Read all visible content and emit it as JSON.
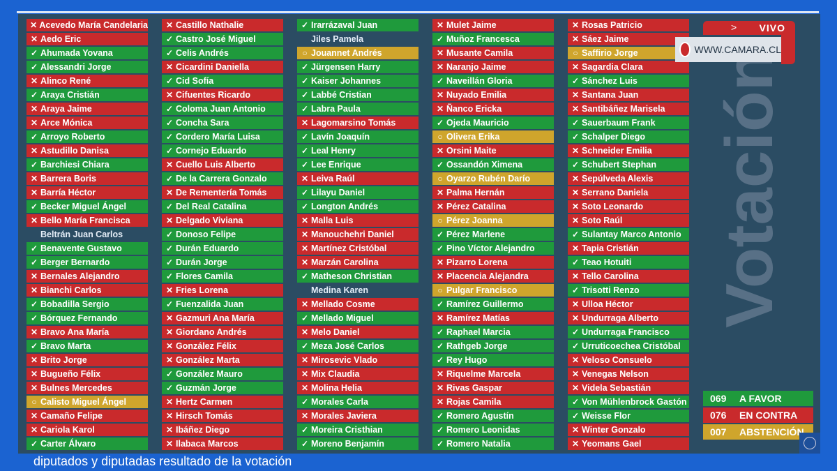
{
  "header": {
    "live_label": "VIVO",
    "url": "WWW.CAMARA.CL",
    "vertical_title": "Votación"
  },
  "colors": {
    "favor": "#1f9a3c",
    "contra": "#c92a2c",
    "abstencion": "#cfa52c",
    "background": "#1b63d1",
    "panel": "#2b4c63"
  },
  "icons": {
    "y": "check-icon",
    "n": "cross-icon",
    "a": "circle-icon"
  },
  "columns": [
    [
      [
        "n",
        "Acevedo María Candelaria"
      ],
      [
        "n",
        "Aedo Eric"
      ],
      [
        "y",
        "Ahumada Yovana"
      ],
      [
        "y",
        "Alessandri Jorge"
      ],
      [
        "n",
        "Alinco René"
      ],
      [
        "y",
        "Araya Cristián"
      ],
      [
        "n",
        "Araya Jaime"
      ],
      [
        "n",
        "Arce Mónica"
      ],
      [
        "y",
        "Arroyo Roberto"
      ],
      [
        "n",
        "Astudillo Danisa"
      ],
      [
        "y",
        "Barchiesi Chiara"
      ],
      [
        "n",
        "Barrera Boris"
      ],
      [
        "n",
        "Barría Héctor"
      ],
      [
        "y",
        "Becker Miguel Ángel"
      ],
      [
        "n",
        "Bello María Francisca"
      ],
      [
        "",
        "Beltrán Juan Carlos"
      ],
      [
        "y",
        "Benavente Gustavo"
      ],
      [
        "y",
        "Berger Bernardo"
      ],
      [
        "n",
        "Bernales Alejandro"
      ],
      [
        "n",
        "Bianchi Carlos"
      ],
      [
        "y",
        "Bobadilla Sergio"
      ],
      [
        "y",
        "Bórquez Fernando"
      ],
      [
        "n",
        "Bravo Ana María"
      ],
      [
        "y",
        "Bravo Marta"
      ],
      [
        "n",
        "Brito Jorge"
      ],
      [
        "n",
        "Bugueño Félix"
      ],
      [
        "n",
        "Bulnes Mercedes"
      ],
      [
        "a",
        "Calisto Miguel Ángel"
      ],
      [
        "n",
        "Camaño Felipe"
      ],
      [
        "n",
        "Cariola Karol"
      ],
      [
        "y",
        "Carter Álvaro"
      ]
    ],
    [
      [
        "n",
        "Castillo Nathalie"
      ],
      [
        "y",
        "Castro José Miguel"
      ],
      [
        "y",
        "Celis Andrés"
      ],
      [
        "n",
        "Cicardini Daniella"
      ],
      [
        "y",
        "Cid Sofía"
      ],
      [
        "n",
        "Cifuentes Ricardo"
      ],
      [
        "y",
        "Coloma Juan Antonio"
      ],
      [
        "y",
        "Concha Sara"
      ],
      [
        "y",
        "Cordero María Luisa"
      ],
      [
        "y",
        "Cornejo Eduardo"
      ],
      [
        "n",
        "Cuello Luis Alberto"
      ],
      [
        "y",
        "De la Carrera Gonzalo"
      ],
      [
        "n",
        "De Rementería Tomás"
      ],
      [
        "y",
        "Del Real Catalina"
      ],
      [
        "n",
        "Delgado Viviana"
      ],
      [
        "y",
        "Donoso Felipe"
      ],
      [
        "y",
        "Durán Eduardo"
      ],
      [
        "y",
        "Durán Jorge"
      ],
      [
        "y",
        "Flores Camila"
      ],
      [
        "n",
        "Fries Lorena"
      ],
      [
        "y",
        "Fuenzalida Juan"
      ],
      [
        "n",
        "Gazmuri Ana María"
      ],
      [
        "n",
        "Giordano Andrés"
      ],
      [
        "n",
        "González Félix"
      ],
      [
        "n",
        "González Marta"
      ],
      [
        "y",
        "González Mauro"
      ],
      [
        "y",
        "Guzmán Jorge"
      ],
      [
        "n",
        "Hertz Carmen"
      ],
      [
        "n",
        "Hirsch Tomás"
      ],
      [
        "n",
        "Ibáñez Diego"
      ],
      [
        "n",
        "Ilabaca Marcos"
      ]
    ],
    [
      [
        "y",
        "Irarrázaval Juan"
      ],
      [
        "",
        "Jiles Pamela"
      ],
      [
        "a",
        "Jouannet Andrés"
      ],
      [
        "y",
        "Jürgensen Harry"
      ],
      [
        "y",
        "Kaiser Johannes"
      ],
      [
        "y",
        "Labbé Cristian"
      ],
      [
        "y",
        "Labra Paula"
      ],
      [
        "n",
        "Lagomarsino Tomás"
      ],
      [
        "y",
        "Lavín Joaquín"
      ],
      [
        "y",
        "Leal Henry"
      ],
      [
        "y",
        "Lee Enrique"
      ],
      [
        "n",
        "Leiva Raúl"
      ],
      [
        "y",
        "Lilayu Daniel"
      ],
      [
        "y",
        "Longton Andrés"
      ],
      [
        "n",
        "Malla Luis"
      ],
      [
        "n",
        "Manouchehri Daniel"
      ],
      [
        "n",
        "Martínez Cristóbal"
      ],
      [
        "n",
        "Marzán Carolina"
      ],
      [
        "y",
        "Matheson Christian"
      ],
      [
        "",
        "Medina Karen"
      ],
      [
        "n",
        "Mellado Cosme"
      ],
      [
        "y",
        "Mellado Miguel"
      ],
      [
        "n",
        "Melo Daniel"
      ],
      [
        "y",
        "Meza José Carlos"
      ],
      [
        "n",
        "Mirosevic Vlado"
      ],
      [
        "n",
        "Mix Claudia"
      ],
      [
        "n",
        "Molina Helia"
      ],
      [
        "y",
        "Morales Carla"
      ],
      [
        "n",
        "Morales Javiera"
      ],
      [
        "y",
        "Moreira Cristhian"
      ],
      [
        "y",
        "Moreno Benjamín"
      ]
    ],
    [
      [
        "n",
        "Mulet Jaime"
      ],
      [
        "y",
        "Muñoz Francesca"
      ],
      [
        "n",
        "Musante Camila"
      ],
      [
        "n",
        "Naranjo Jaime"
      ],
      [
        "y",
        "Naveillán Gloria"
      ],
      [
        "n",
        "Nuyado Emilia"
      ],
      [
        "n",
        "Ñanco Ericka"
      ],
      [
        "y",
        "Ojeda Mauricio"
      ],
      [
        "a",
        "Olivera Erika"
      ],
      [
        "n",
        "Orsini Maite"
      ],
      [
        "y",
        "Ossandón Ximena"
      ],
      [
        "a",
        "Oyarzo Rubén Darío"
      ],
      [
        "n",
        "Palma Hernán"
      ],
      [
        "n",
        "Pérez Catalina"
      ],
      [
        "a",
        "Pérez Joanna"
      ],
      [
        "y",
        "Pérez Marlene"
      ],
      [
        "y",
        "Pino Víctor Alejandro"
      ],
      [
        "n",
        "Pizarro Lorena"
      ],
      [
        "n",
        "Placencia Alejandra"
      ],
      [
        "a",
        "Pulgar Francisco"
      ],
      [
        "y",
        "Ramírez Guillermo"
      ],
      [
        "n",
        "Ramírez Matías"
      ],
      [
        "y",
        "Raphael Marcia"
      ],
      [
        "y",
        "Rathgeb Jorge"
      ],
      [
        "y",
        "Rey Hugo"
      ],
      [
        "n",
        "Riquelme Marcela"
      ],
      [
        "n",
        "Rivas Gaspar"
      ],
      [
        "n",
        "Rojas Camila"
      ],
      [
        "y",
        "Romero Agustín"
      ],
      [
        "y",
        "Romero Leonidas"
      ],
      [
        "y",
        "Romero Natalia"
      ]
    ],
    [
      [
        "n",
        "Rosas Patricio"
      ],
      [
        "n",
        "Sáez Jaime"
      ],
      [
        "a",
        "Saffirio Jorge"
      ],
      [
        "n",
        "Sagardia Clara"
      ],
      [
        "y",
        "Sánchez Luis"
      ],
      [
        "n",
        "Santana Juan"
      ],
      [
        "n",
        "Santibáñez Marisela"
      ],
      [
        "y",
        "Sauerbaum Frank"
      ],
      [
        "y",
        "Schalper Diego"
      ],
      [
        "n",
        "Schneider Emilia"
      ],
      [
        "y",
        "Schubert Stephan"
      ],
      [
        "n",
        "Sepúlveda Alexis"
      ],
      [
        "n",
        "Serrano Daniela"
      ],
      [
        "n",
        "Soto Leonardo"
      ],
      [
        "n",
        "Soto Raúl"
      ],
      [
        "y",
        "Sulantay Marco Antonio"
      ],
      [
        "n",
        "Tapia Cristián"
      ],
      [
        "y",
        "Teao Hotuiti"
      ],
      [
        "n",
        "Tello Carolina"
      ],
      [
        "y",
        "Trisotti Renzo"
      ],
      [
        "n",
        "Ulloa Héctor"
      ],
      [
        "n",
        "Undurraga Alberto"
      ],
      [
        "y",
        "Undurraga Francisco"
      ],
      [
        "y",
        "Urruticoechea Cristóbal"
      ],
      [
        "n",
        "Veloso Consuelo"
      ],
      [
        "n",
        "Venegas Nelson"
      ],
      [
        "n",
        "Videla Sebastián"
      ],
      [
        "y",
        "Von Mühlenbrock Gastón"
      ],
      [
        "y",
        "Weisse Flor"
      ],
      [
        "n",
        "Winter Gonzalo"
      ],
      [
        "n",
        "Yeomans Gael"
      ]
    ]
  ],
  "totals": [
    {
      "count": "069",
      "label": "A FAVOR",
      "type": "y"
    },
    {
      "count": "076",
      "label": "EN CONTRA",
      "type": "n"
    },
    {
      "count": "007",
      "label": "ABSTENCIÓN",
      "type": "a"
    }
  ],
  "caption": "diputados y diputadas resultado de la votación"
}
